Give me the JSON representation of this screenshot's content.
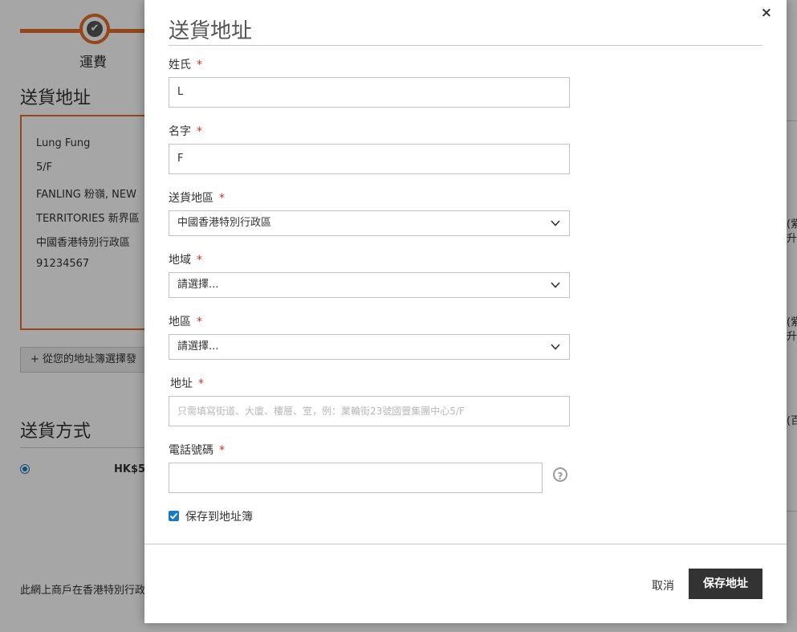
{
  "background": {
    "step_label": "運費",
    "address_heading": "送貨地址",
    "address_lines": [
      "Lung Fung",
      "5/F",
      "FANLING 粉嶺, NEW",
      "TERRITORIES 新界區",
      "中國香港特別行政區",
      "91234567"
    ],
    "add_from_book_button": "+ 從您的地址簿選擇發",
    "shipping_heading": "送貨方式",
    "shipping_price": "HK$5",
    "footer_note": "此網上商戶在香港特別行政",
    "right_fragments": [
      "(紫",
      "升",
      "(紫",
      "升",
      "(百"
    ]
  },
  "modal": {
    "title": "送貨地址",
    "close_symbol": "×",
    "fields": {
      "last_name": {
        "label": "姓氏",
        "value": "L"
      },
      "first_name": {
        "label": "名字",
        "value": "F"
      },
      "country": {
        "label": "送貨地區",
        "value": "中國香港特別行政區"
      },
      "region": {
        "label": "地域",
        "value": "請選擇..."
      },
      "district": {
        "label": "地區",
        "value": "請選擇..."
      },
      "address": {
        "label": "地址",
        "placeholder": "只需填寫街道、大廈、樓層、室，例：業輪街23號國豐集團中心5/F"
      },
      "phone": {
        "label": "電話號碼",
        "value": ""
      }
    },
    "required_mark": "*",
    "help_symbol": "?",
    "save_to_book": {
      "label": "保存到地址簿",
      "checked": true
    },
    "cancel_label": "取消",
    "save_label": "保存地址"
  },
  "colors": {
    "accent": "#e26d28",
    "primary_button": "#333333",
    "checkbox": "#1979c3",
    "required": "#e02b27"
  }
}
